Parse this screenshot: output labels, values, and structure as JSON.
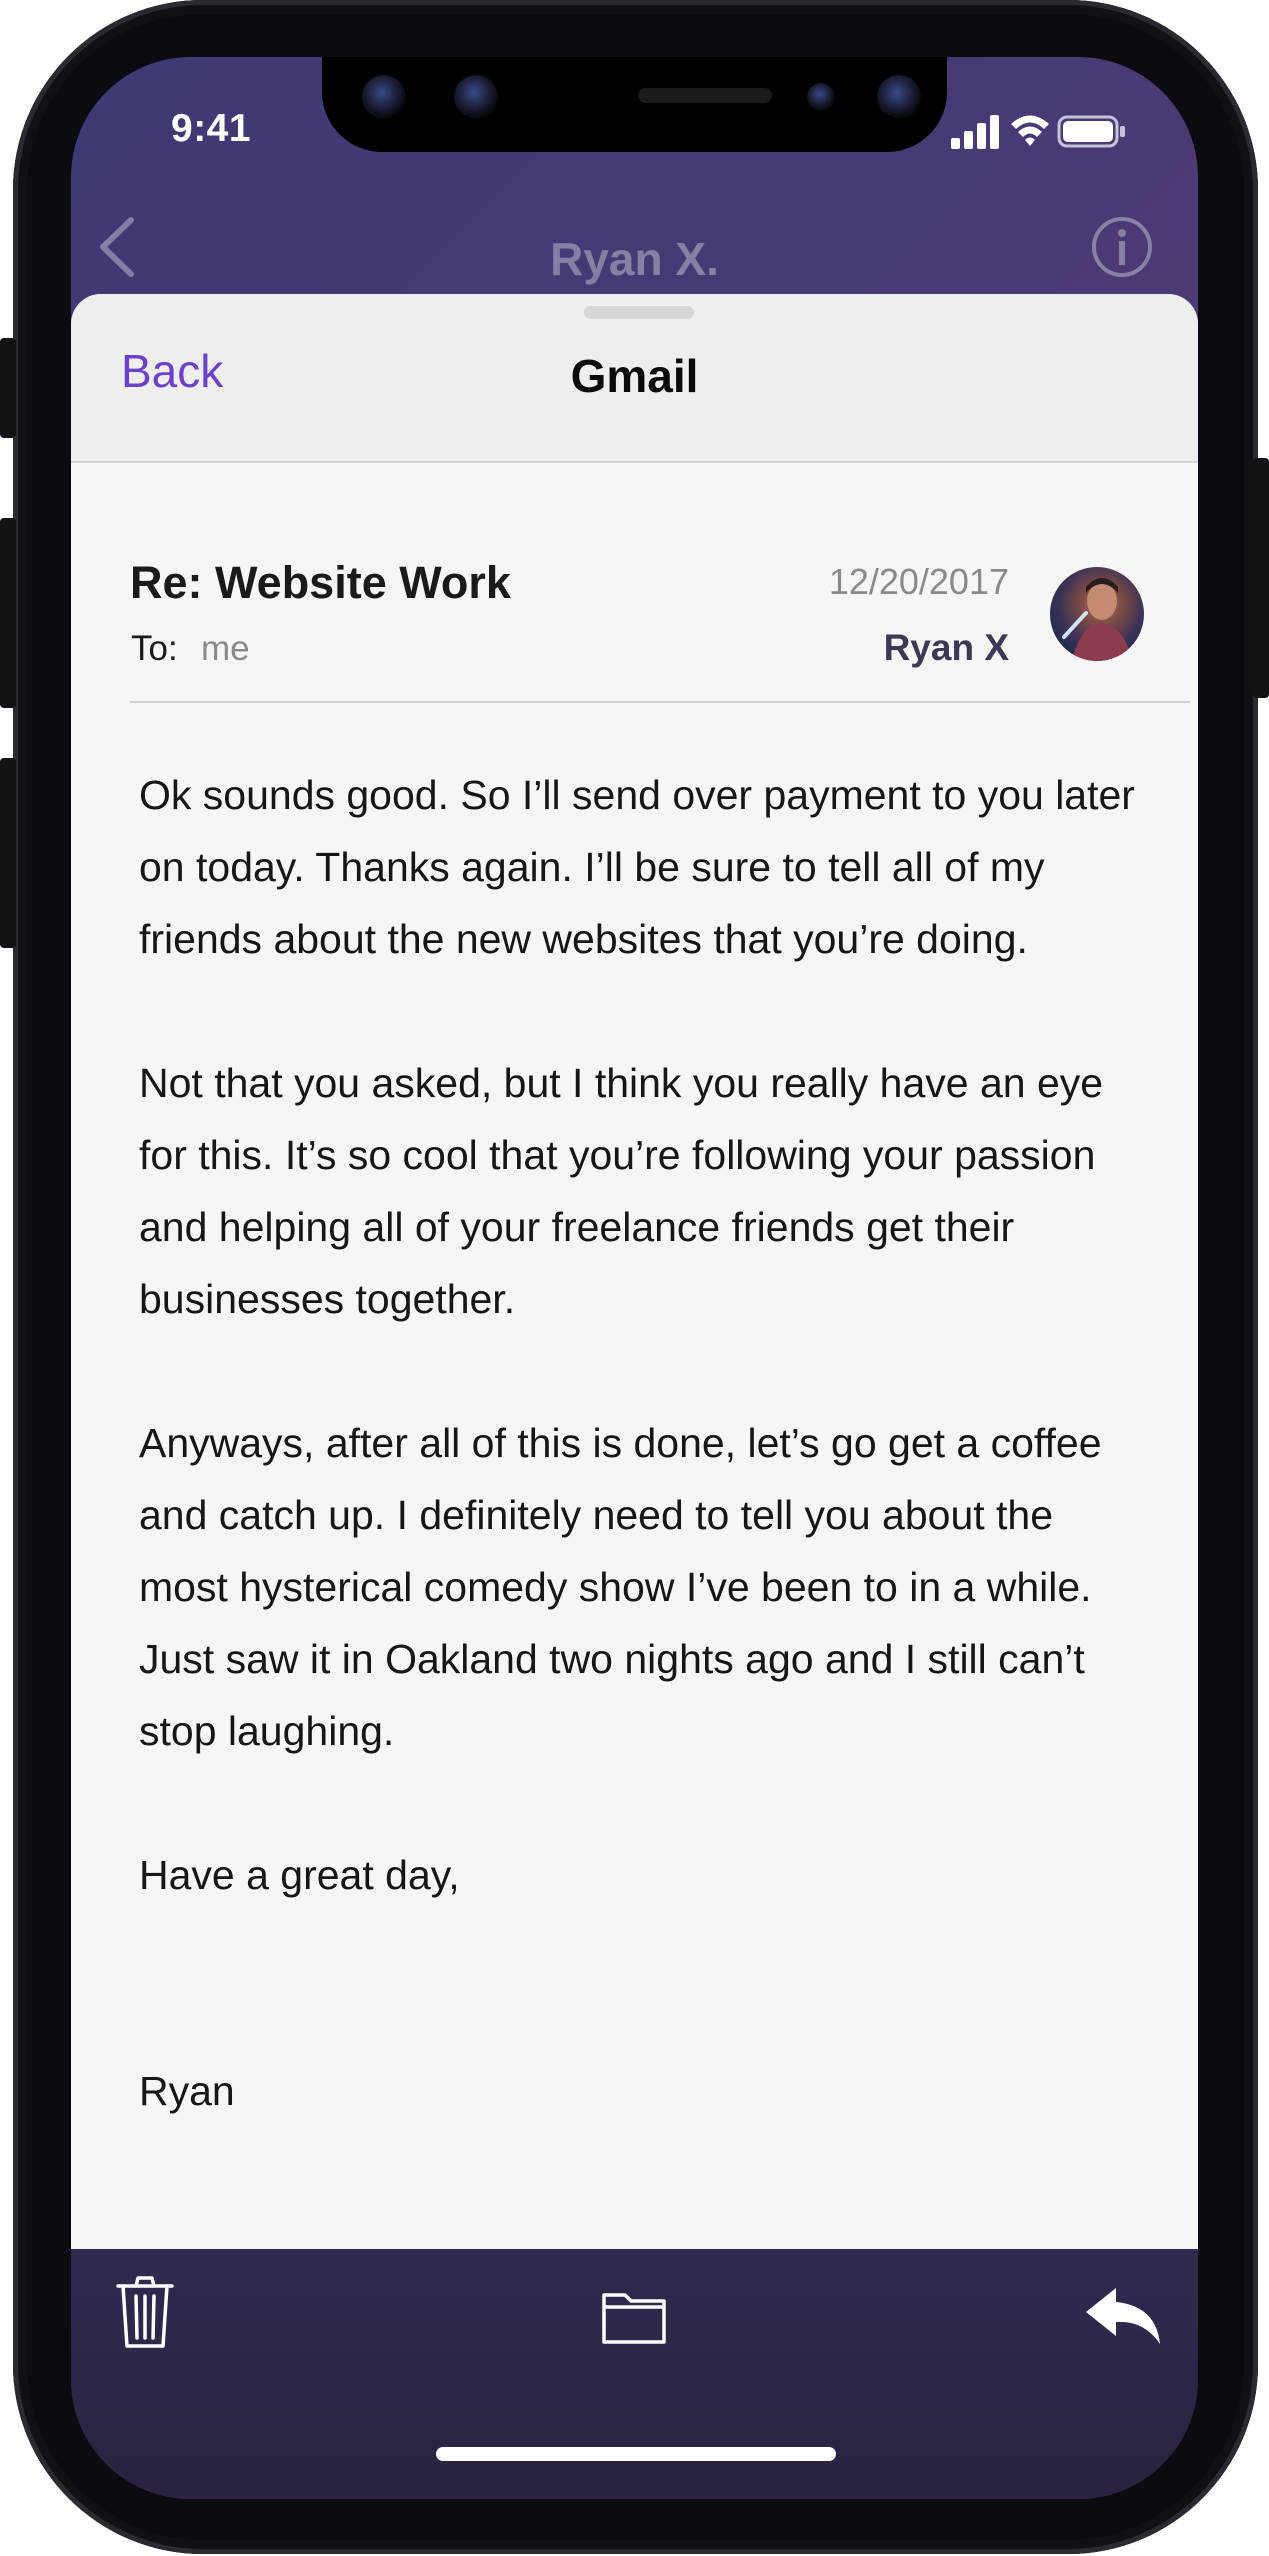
{
  "status_bar": {
    "time": "9:41",
    "icons": [
      "cellular-signal-icon",
      "wifi-icon",
      "battery-icon"
    ]
  },
  "background_nav": {
    "title": "Ryan X.",
    "icons": [
      "chevron-left-icon",
      "info-icon"
    ]
  },
  "sheet": {
    "back_label": "Back",
    "title": "Gmail"
  },
  "email": {
    "subject": "Re: Website Work",
    "to_label": "To:",
    "to_value": "me",
    "date": "12/20/2017",
    "sender": "Ryan X",
    "paragraphs": [
      "Ok sounds good. So I’ll send over payment to you later on today. Thanks again. I’ll be sure to tell all of my friends about the new websites that you’re doing.",
      "Not that you asked, but I think you really have an eye for this. It’s so cool that you’re following your passion and helping all of your freelance friends get their businesses together.",
      "Anyways, after all of this is done, let’s go get a coffee and catch up. I definitely need to tell you about the most hysterical comedy show I’ve been to in a while. Just saw it in Oakland two nights ago and I still can’t stop laughing.",
      "Have a great day,"
    ],
    "signature": "Ryan"
  },
  "toolbar": {
    "icons": [
      "trash-icon",
      "folder-icon",
      "reply-icon"
    ]
  },
  "colors": {
    "accent": "#6b41c9",
    "header_gradient_start": "#3d3a74",
    "header_gradient_end": "#5f3a6c",
    "toolbar": "#2d2646",
    "sender": "#3c3954"
  }
}
